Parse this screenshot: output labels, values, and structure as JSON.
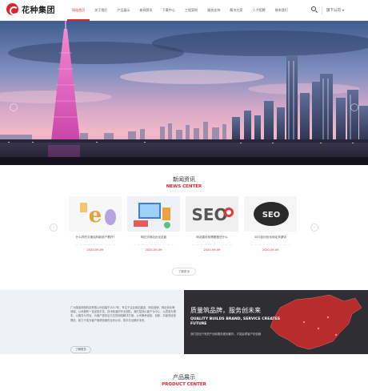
{
  "brand": {
    "logo_text": "花种集团",
    "accent": "#d8262c"
  },
  "nav": {
    "items": [
      "网站首页",
      "关于我们",
      "产品展示",
      "新闻资讯",
      "下载中心",
      "工程案例",
      "服务支持",
      "解决方案",
      "人才招聘",
      "联系我们"
    ],
    "active_index": 0
  },
  "header": {
    "language": "旗下公司",
    "search_icon": "search-icon"
  },
  "news": {
    "title_cn": "新闻资讯",
    "title_en": "NEWS CENTER",
    "items": [
      {
        "title": "什么样的文案结构能用户看好?",
        "date": "2020-09-09"
      },
      {
        "title": "响应式网站优化技能",
        "date": "2020-09-09"
      },
      {
        "title": "网站建设前需要做些什么",
        "date": "2020-09-09"
      },
      {
        "title": "SEO如何优化网站关键词",
        "date": "2020-09-09"
      }
    ],
    "more_label": "了解更多"
  },
  "about": {
    "text": "广州某某网络科技有限公司创建于2017年，专注于企业网站建设、网站营销、网站优化等领域，公司拥有一支经验丰富、技术精湛的专业团队。我们坚持以客户为中心，以质量为根本，以服务为宗旨，为客户提供全方位的网络解决方案。公司秉承诚信、创新、共赢的经营理念，致力于成为客户值得信赖的合作伙伴，携手共创美好未来。",
    "more_label": "了解更多",
    "slogan_cn": "质量筑品牌，服务创未来",
    "slogan_en": "QUALITY BUILDS BRAND, SERVICE CREATES FUTURE",
    "slogan_sub": "我们坚信只有把产品和服务做到最好，才能赢得客户的信赖"
  },
  "products": {
    "title_cn": "产品展示",
    "title_en": "PRODUCT CENTER"
  }
}
